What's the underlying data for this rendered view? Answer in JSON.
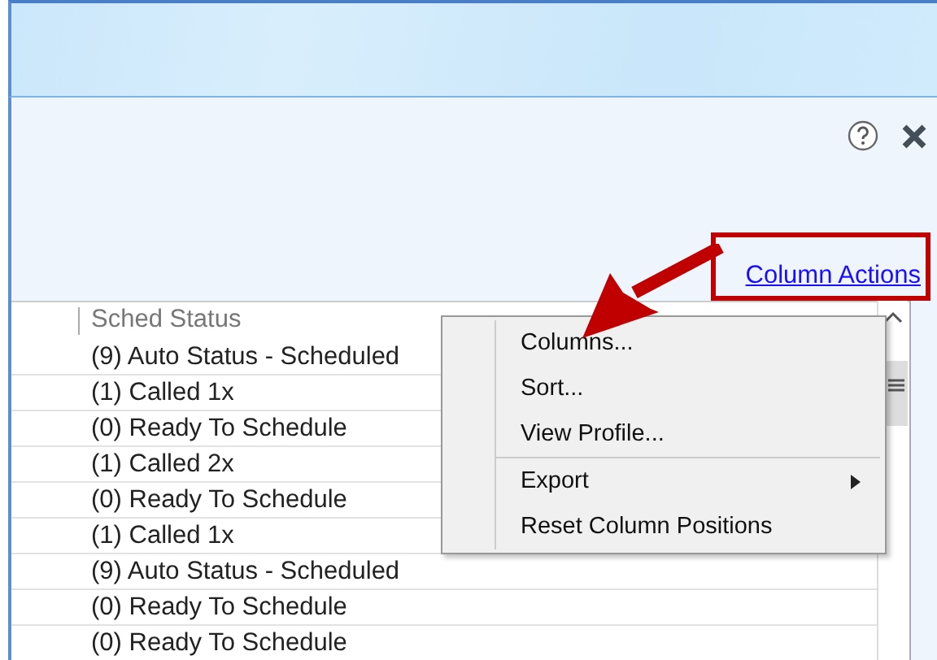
{
  "toolbar": {
    "link": "Column Actions"
  },
  "table": {
    "columns": [
      "Sched Status"
    ],
    "rows": [
      "(9) Auto Status - Scheduled",
      "(1) Called 1x",
      "(0) Ready To Schedule",
      "(1) Called 2x",
      "(0) Ready To Schedule",
      "(1) Called 1x",
      "(9) Auto Status - Scheduled",
      "(0) Ready To Schedule",
      "(0) Ready To Schedule"
    ]
  },
  "context_menu": {
    "groups": [
      [
        {
          "label": "Columns...",
          "kind": "item"
        },
        {
          "label": "Sort...",
          "kind": "item"
        },
        {
          "label": "View Profile...",
          "kind": "item"
        }
      ],
      [
        {
          "label": "Export",
          "kind": "submenu"
        },
        {
          "label": "Reset Column Positions",
          "kind": "item"
        }
      ]
    ]
  }
}
